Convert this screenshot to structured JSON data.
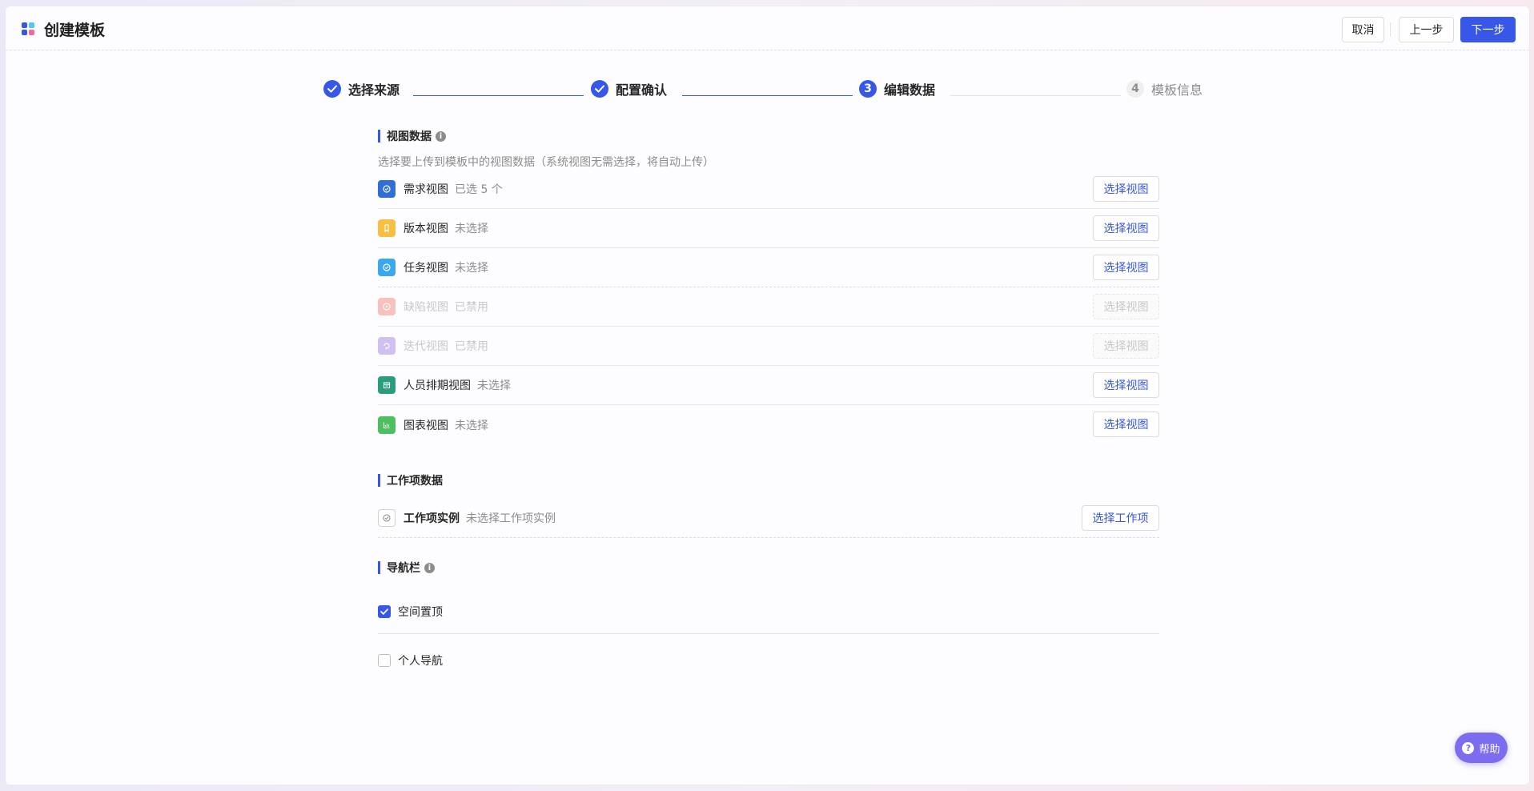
{
  "header": {
    "title": "创建模板",
    "cancel_label": "取消",
    "prev_label": "上一步",
    "next_label": "下一步"
  },
  "steps": [
    {
      "label": "选择来源",
      "state": "done"
    },
    {
      "label": "配置确认",
      "state": "done"
    },
    {
      "label": "编辑数据",
      "state": "active",
      "number": "3"
    },
    {
      "label": "模板信息",
      "state": "todo",
      "number": "4"
    }
  ],
  "view_data": {
    "title": "视图数据",
    "description": "选择要上传到模板中的视图数据（系统视图无需选择，将自动上传）",
    "rows": [
      {
        "name": "需求视图",
        "status": "已选 5 个",
        "button": "选择视图",
        "icon": "requirement-icon",
        "color": "#2f6fd6",
        "disabled": false
      },
      {
        "name": "版本视图",
        "status": "未选择",
        "button": "选择视图",
        "icon": "version-icon",
        "color": "#f5c044",
        "disabled": false
      },
      {
        "name": "任务视图",
        "status": "未选择",
        "button": "选择视图",
        "icon": "task-icon",
        "color": "#3aa7ee",
        "disabled": false
      },
      {
        "name": "缺陷视图",
        "status": "已禁用",
        "button": "选择视图",
        "icon": "bug-icon",
        "color": "#f47a6a",
        "disabled": true
      },
      {
        "name": "迭代视图",
        "status": "已禁用",
        "button": "选择视图",
        "icon": "iteration-icon",
        "color": "#9b78e0",
        "disabled": true
      },
      {
        "name": "人员排期视图",
        "status": "未选择",
        "button": "选择视图",
        "icon": "schedule-icon",
        "color": "#2a9d7c",
        "disabled": false
      },
      {
        "name": "图表视图",
        "status": "未选择",
        "button": "选择视图",
        "icon": "chart-icon",
        "color": "#4cbf5f",
        "disabled": false
      }
    ]
  },
  "work_item_data": {
    "title": "工作项数据",
    "row": {
      "name": "工作项实例",
      "status": "未选择工作项实例",
      "button": "选择工作项"
    }
  },
  "nav": {
    "title": "导航栏",
    "options": [
      {
        "label": "空间置顶",
        "checked": true
      },
      {
        "label": "个人导航",
        "checked": false
      }
    ]
  },
  "help": {
    "label": "帮助"
  },
  "colors": {
    "accent": "#3657e8",
    "help": "#7b6cf0"
  }
}
